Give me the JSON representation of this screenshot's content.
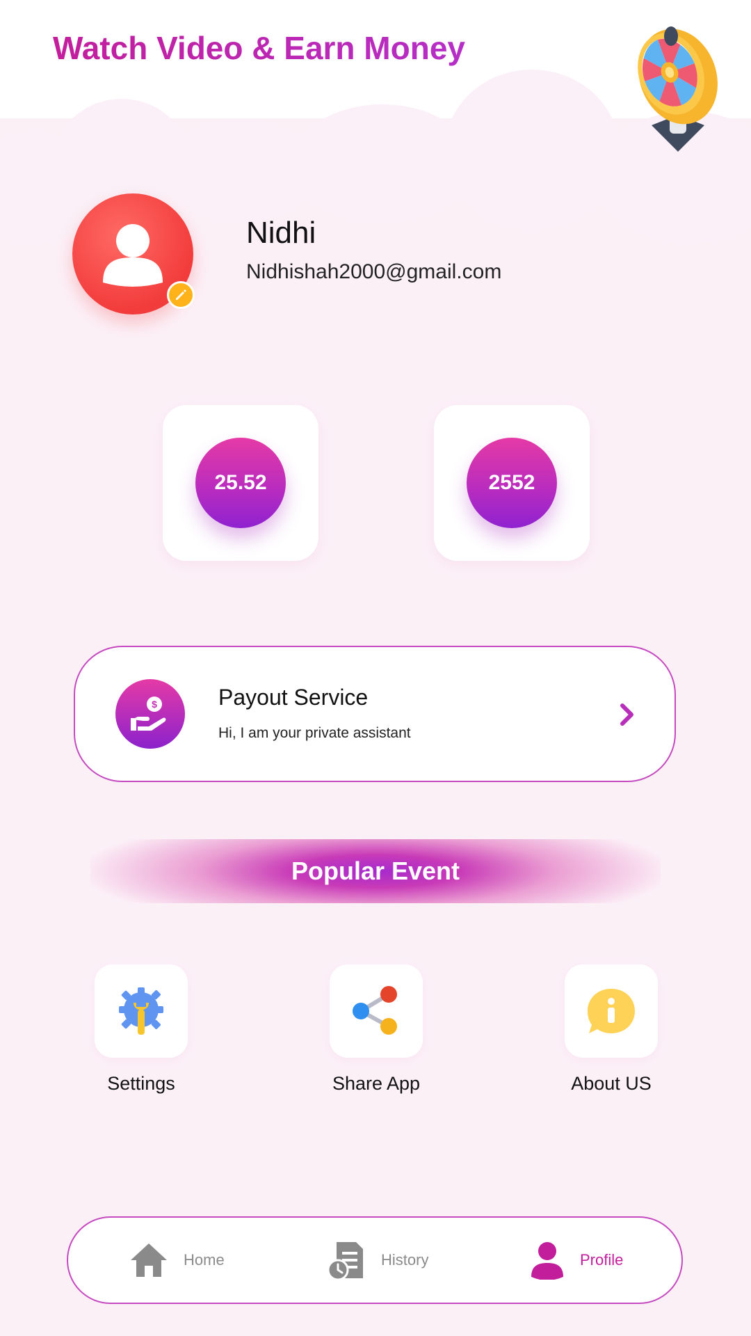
{
  "header": {
    "title": "Watch Video & Earn Money",
    "wheel_icon": "spin-wheel-icon"
  },
  "profile": {
    "name": "Nidhi",
    "email": "Nidhishah2000@gmail.com",
    "avatar_icon": "user-avatar-icon",
    "edit_icon": "pencil-icon"
  },
  "stats": [
    {
      "value": "25.52"
    },
    {
      "value": "2552"
    }
  ],
  "payout": {
    "title": "Payout Service",
    "subtitle": "Hi, I am your private assistant",
    "icon": "hand-money-icon"
  },
  "popular_event": {
    "label": "Popular Event"
  },
  "actions": [
    {
      "label": "Settings",
      "icon": "gear-wrench-icon"
    },
    {
      "label": "Share App",
      "icon": "share-icon"
    },
    {
      "label": "About US",
      "icon": "info-bubble-icon"
    }
  ],
  "bottom_nav": [
    {
      "label": "Home",
      "icon": "home-icon",
      "active": false
    },
    {
      "label": "History",
      "icon": "history-icon",
      "active": false
    },
    {
      "label": "Profile",
      "icon": "profile-icon",
      "active": true
    }
  ],
  "colors": {
    "accent": "#c21e9c",
    "accent_purple": "#8f22d0",
    "background": "#fcf0f7",
    "inactive_nav": "#8a8a8a"
  }
}
